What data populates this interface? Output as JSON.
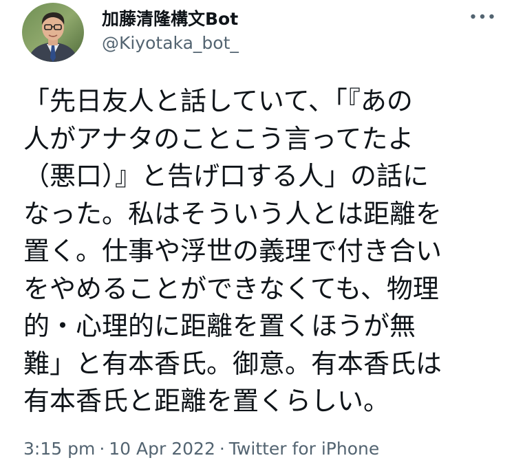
{
  "author": {
    "display_name": "加藤清隆構文Bot",
    "handle": "@Kiyotaka_bot_"
  },
  "tweet": {
    "text": "「先日友人と話していて、「『あの\n人がアナタのことこう言ってたよ\n（悪口）』と告げ口する人」の話に\nなった。私はそういう人とは距離を\n置く。仕事や浮世の義理で付き合い\nをやめることができなくても、物理\n的・心理的に距離を置くほうが無\n難」と有本香氏。御意。有本香氏は\n有本香氏と距離を置くらしい。"
  },
  "meta": {
    "time": "3:15 pm",
    "separator": "·",
    "date": "10 Apr 2022",
    "source": "Twitter for iPhone"
  },
  "icons": {
    "more": "more-horizontal-icon",
    "avatar": "profile-photo"
  },
  "colors": {
    "text": "#0f1419",
    "secondary": "#536471",
    "background": "#ffffff"
  }
}
